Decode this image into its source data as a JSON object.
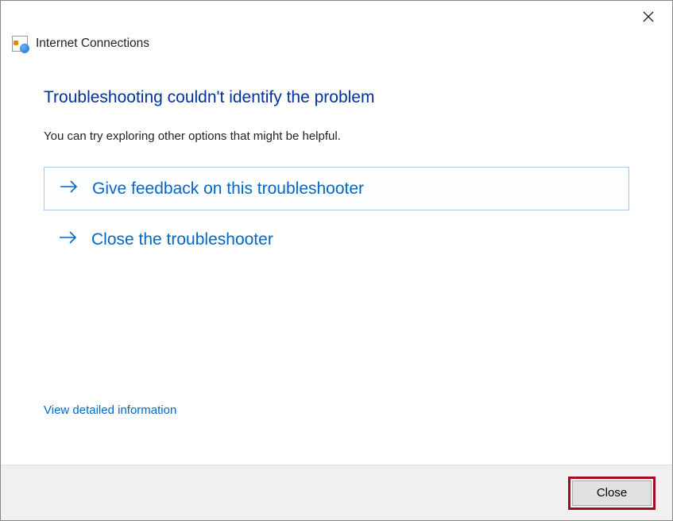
{
  "window": {
    "title": "Internet Connections"
  },
  "main": {
    "headline": "Troubleshooting couldn't identify the problem",
    "subtext": "You can try exploring other options that might be helpful.",
    "options": [
      {
        "label": "Give feedback on this troubleshooter",
        "selected": true
      },
      {
        "label": "Close the troubleshooter",
        "selected": false
      }
    ],
    "details_link": "View detailed information"
  },
  "footer": {
    "close_label": "Close"
  }
}
